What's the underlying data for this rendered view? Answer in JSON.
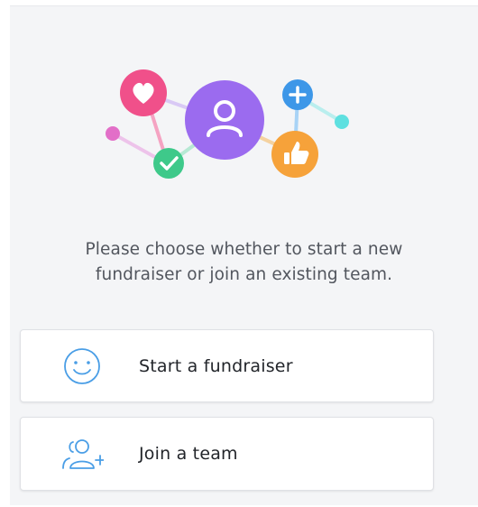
{
  "prompt": {
    "line1": "Please choose whether to start a new",
    "line2": "fundraiser or join an existing team."
  },
  "options": [
    {
      "label": "Start a fundraiser",
      "icon": "smiley-face-icon"
    },
    {
      "label": "Join a team",
      "icon": "add-team-member-icon"
    }
  ],
  "illustration": {
    "icons": [
      "heart-icon",
      "user-icon",
      "plus-icon",
      "check-icon",
      "thumbs-up-icon"
    ]
  },
  "colors": {
    "background": "#f4f5f7",
    "heart": "#f0508a",
    "user": "#9b6bef",
    "plus": "#3d97e8",
    "check": "#3ec98a",
    "thumbs": "#f6a23a",
    "pinkDot": "#e26fc8",
    "tealDot": "#5ee0e0",
    "iconStroke": "#4a9ee6"
  }
}
